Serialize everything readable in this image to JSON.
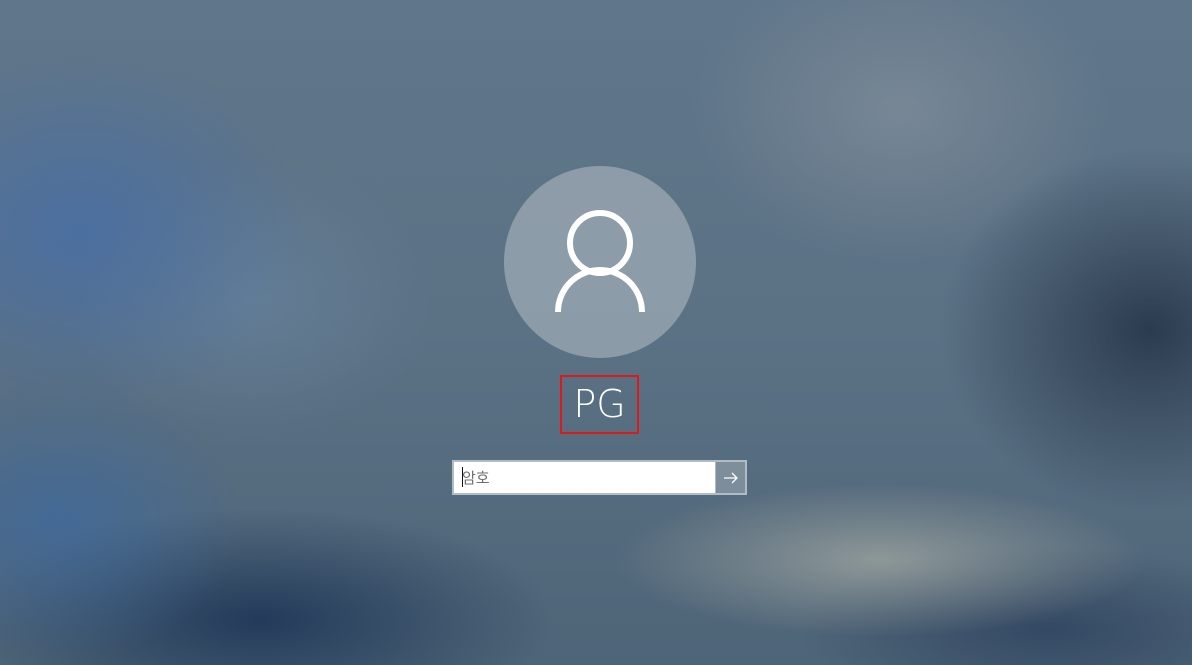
{
  "user": {
    "name": "PG",
    "avatar_icon": "user-silhouette-icon"
  },
  "password": {
    "placeholder": "암호",
    "value": "",
    "submit_icon": "arrow-right-icon"
  },
  "colors": {
    "highlight": "#e01818",
    "text": "#ffffff"
  }
}
